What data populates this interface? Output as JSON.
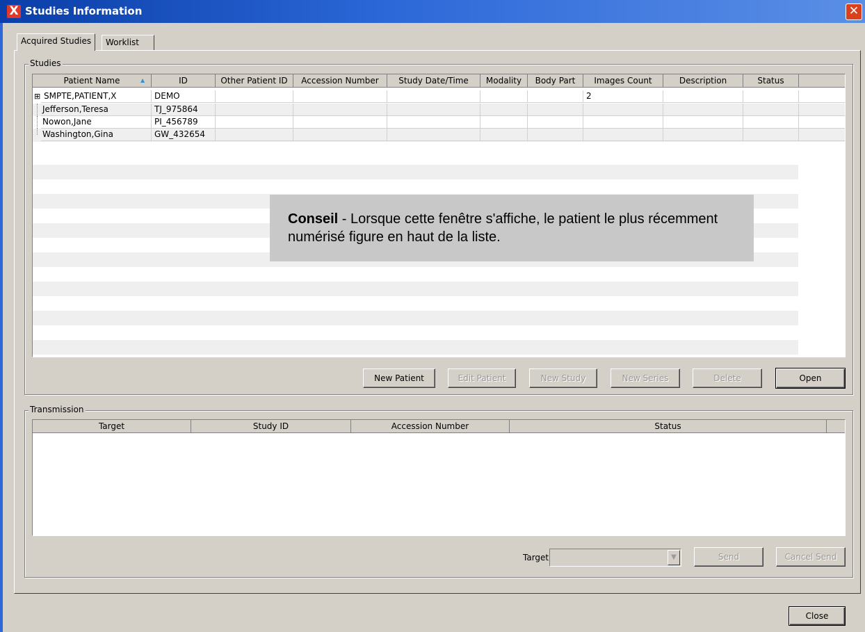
{
  "window": {
    "title": "Studies Information",
    "logo_glyph": "X",
    "close_glyph": "✕",
    "accent_color": "#0a3ea8",
    "close_color": "#d9411e"
  },
  "tabs": [
    {
      "label": "Acquired Studies",
      "selected": true
    },
    {
      "label": "Worklist",
      "selected": false
    }
  ],
  "studies": {
    "group_label": "Studies",
    "columns": [
      "Patient Name",
      "ID",
      "Other Patient ID",
      "Accession Number",
      "Study Date/Time",
      "Modality",
      "Body Part",
      "Images Count",
      "Description",
      "Status"
    ],
    "sort_indicator": "▲",
    "rows": [
      {
        "name": "SMPTE,PATIENT,X",
        "id": "DEMO",
        "images_count": "2",
        "expand_glyph": "⊞"
      },
      {
        "name": "Jefferson,Teresa",
        "id": "TJ_975864",
        "images_count": ""
      },
      {
        "name": "Nowon,Jane",
        "id": "PI_456789",
        "images_count": ""
      },
      {
        "name": "Washington,Gina",
        "id": "GW_432654",
        "images_count": ""
      }
    ],
    "buttons": {
      "new_patient": "New Patient",
      "edit_patient": "Edit Patient",
      "new_study": "New Study",
      "new_series": "New Series",
      "delete": "Delete",
      "open": "Open"
    }
  },
  "tip": {
    "bold": "Conseil",
    "text": " - Lorsque cette fenêtre s'affiche, le patient le plus récemment numérisé figure en haut de la liste."
  },
  "transmission": {
    "group_label": "Transmission",
    "columns": [
      "Target",
      "Study ID",
      "Accession Number",
      "Status"
    ],
    "target_label": "Target:",
    "target_value": "",
    "combo_arrow": "▼",
    "send": "Send",
    "cancel_send": "Cancel Send"
  },
  "footer": {
    "close": "Close"
  }
}
